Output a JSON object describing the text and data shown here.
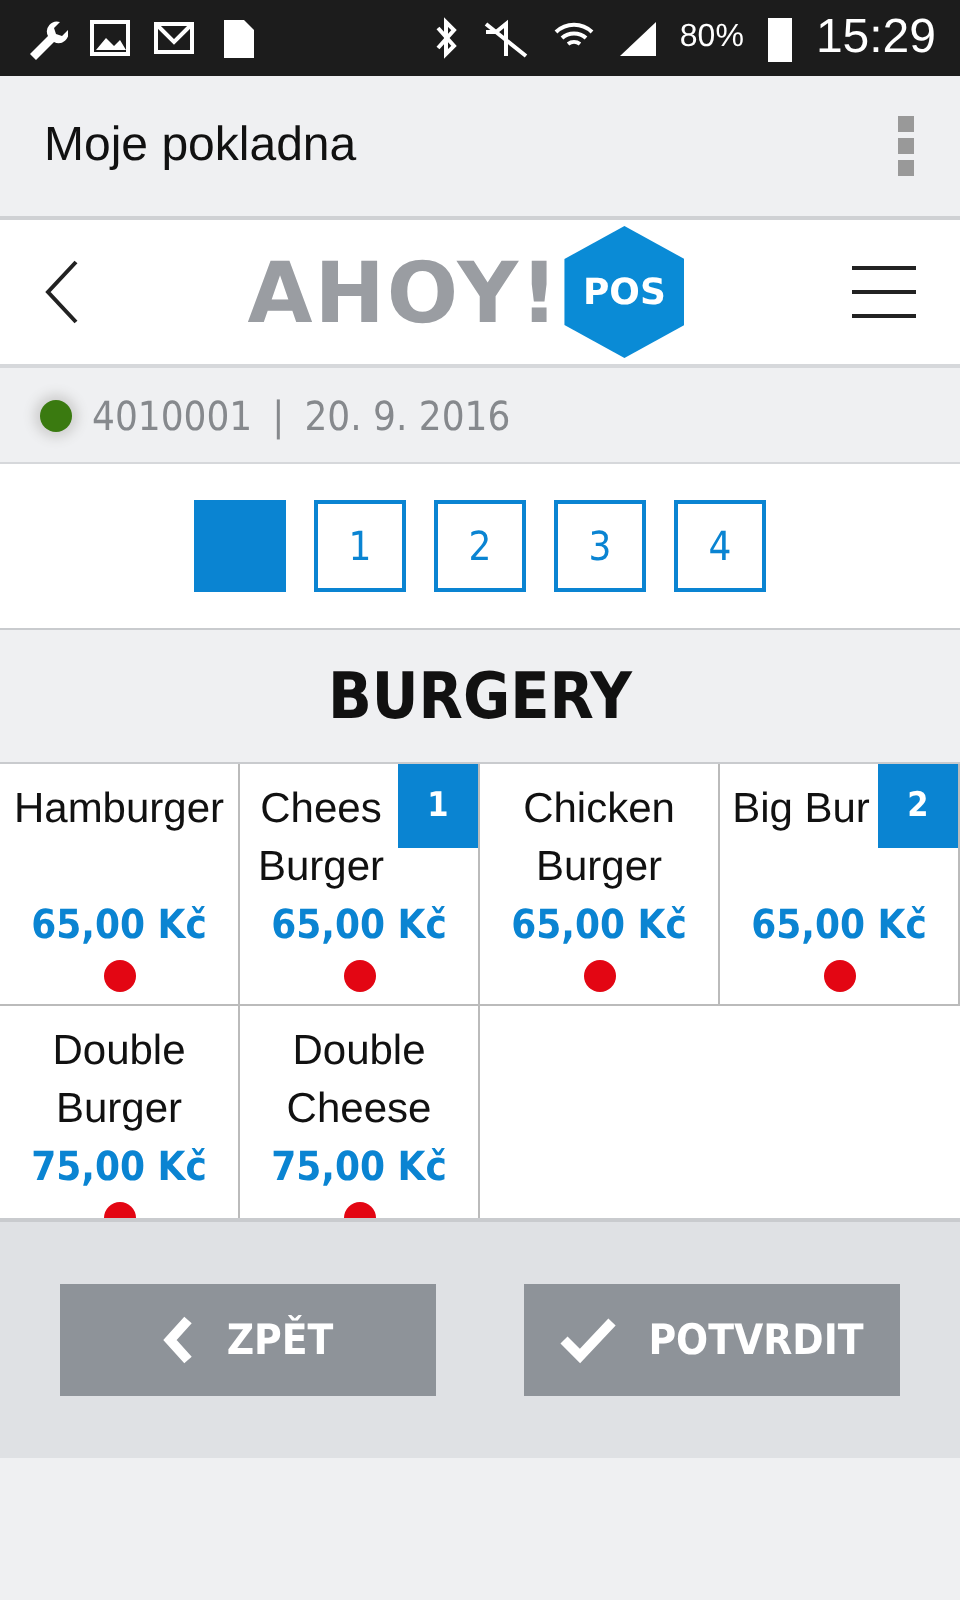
{
  "status_bar": {
    "battery": "80%",
    "time": "15:29"
  },
  "app_bar": {
    "title": "Moje pokladna"
  },
  "logo": {
    "word": "AHOY!",
    "badge": "POS"
  },
  "info": {
    "online": true,
    "register": "4010001",
    "separator": "|",
    "date": "20. 9. 2016"
  },
  "pages": [
    {
      "kind": "current",
      "selected": true
    },
    {
      "kind": "number",
      "label": "1",
      "selected": false
    },
    {
      "kind": "number",
      "label": "2",
      "selected": false
    },
    {
      "kind": "number",
      "label": "3",
      "selected": false
    },
    {
      "kind": "number",
      "label": "4",
      "selected": false
    }
  ],
  "category": "BURGERY",
  "products": [
    {
      "name_lines": [
        "Hamburger"
      ],
      "price": "65,00 Kč",
      "color": "#e30613"
    },
    {
      "name_lines": [
        "Chees",
        "Burger"
      ],
      "price": "65,00 Kč",
      "color": "#e30613",
      "count": "1"
    },
    {
      "name_lines": [
        "Chicken",
        "Burger"
      ],
      "price": "65,00 Kč",
      "color": "#e30613"
    },
    {
      "name_lines": [
        "Big Bur"
      ],
      "price": "65,00 Kč",
      "color": "#e30613",
      "count": "2"
    },
    {
      "name_lines": [
        "Double",
        "Burger"
      ],
      "price": "75,00 Kč",
      "color": "#e30613"
    },
    {
      "name_lines": [
        "Double",
        "Cheese"
      ],
      "price": "75,00 Kč",
      "color": "#e30613"
    }
  ],
  "buttons": [
    {
      "kind": "back",
      "label": "ZPĚT"
    },
    {
      "kind": "confirm",
      "label": "POTVRDIT"
    }
  ]
}
